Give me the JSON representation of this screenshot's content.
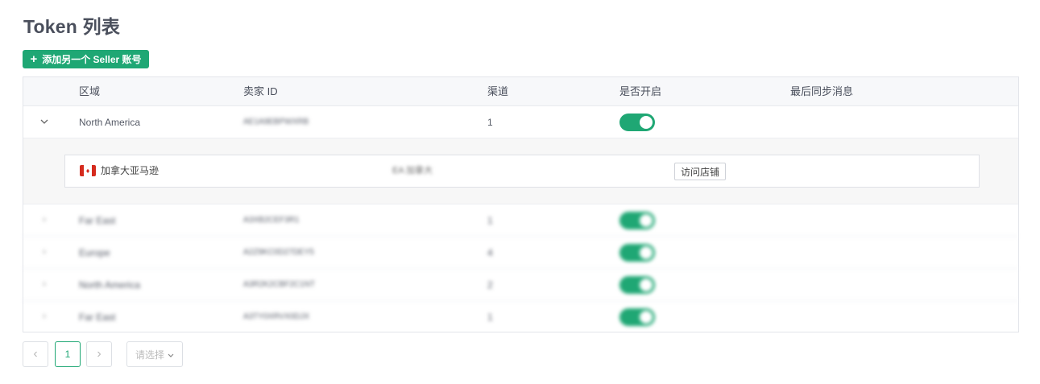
{
  "page": {
    "title": "Token 列表"
  },
  "toolbar": {
    "add_icon": "+",
    "add_label": "添加另一个 Seller 账号"
  },
  "table": {
    "columns": [
      "区域",
      "卖家 ID",
      "渠道",
      "是否开启",
      "最后同步消息"
    ],
    "rows": [
      {
        "region": "North America",
        "seller_id": "AE1A9EBPWXRB",
        "channel": "1",
        "enabled": true
      },
      {
        "region": "Far East",
        "seller_id": "A3XB2CEF3R1",
        "channel": "1",
        "enabled": true
      },
      {
        "region": "Europe",
        "seller_id": "A2Z9KC0D27DEY5",
        "channel": "4",
        "enabled": true
      },
      {
        "region": "North America",
        "seller_id": "A3R2K2CBF2C1NT",
        "channel": "2",
        "enabled": true
      },
      {
        "region": "Far East",
        "seller_id": "A3TY0XRVX0DJX",
        "channel": "1",
        "enabled": true
      }
    ],
    "expanded": {
      "flag_icon": "canada-flag",
      "name": "加拿大亚马逊",
      "tag": "EA 加拿大",
      "visit_label": "访问店铺"
    }
  },
  "pagination": {
    "prev": "‹",
    "current": "1",
    "next": "›",
    "size_placeholder": "请选择",
    "size_arrow": "⌄"
  },
  "colors": {
    "accent": "#1fa774",
    "title": "#4a4f5c"
  }
}
